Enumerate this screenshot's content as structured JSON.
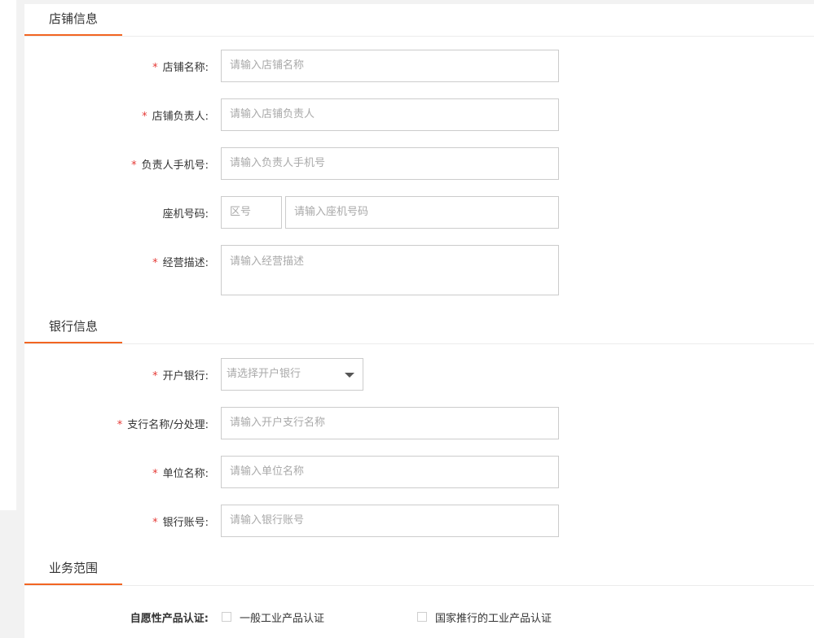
{
  "sections": {
    "store": {
      "title": "店铺信息"
    },
    "bank": {
      "title": "银行信息"
    },
    "business": {
      "title": "业务范围"
    }
  },
  "store_fields": {
    "name": {
      "label": "店铺名称:",
      "placeholder": "请输入店铺名称"
    },
    "manager": {
      "label": "店铺负责人:",
      "placeholder": "请输入店铺负责人"
    },
    "phone": {
      "label": "负责人手机号:",
      "placeholder": "请输入负责人手机号"
    },
    "landline": {
      "label": "座机号码:",
      "area_placeholder": "区号",
      "placeholder": "请输入座机号码"
    },
    "description": {
      "label": "经营描述:",
      "placeholder": "请输入经营描述"
    }
  },
  "bank_fields": {
    "bank": {
      "label": "开户银行:",
      "placeholder": "请选择开户银行"
    },
    "branch": {
      "label": "支行名称/分处理:",
      "placeholder": "请输入开户支行名称"
    },
    "company": {
      "label": "单位名称:",
      "placeholder": "请输入单位名称"
    },
    "account": {
      "label": "银行账号:",
      "placeholder": "请输入银行账号"
    }
  },
  "business_fields": {
    "certification": {
      "label": "自愿性产品认证:",
      "options": [
        "一般工业产品认证",
        "国家推行的工业产品认证"
      ]
    }
  },
  "required_mark": "*",
  "colors": {
    "accent": "#f26522",
    "required": "#e53935",
    "border": "#cccccc"
  }
}
